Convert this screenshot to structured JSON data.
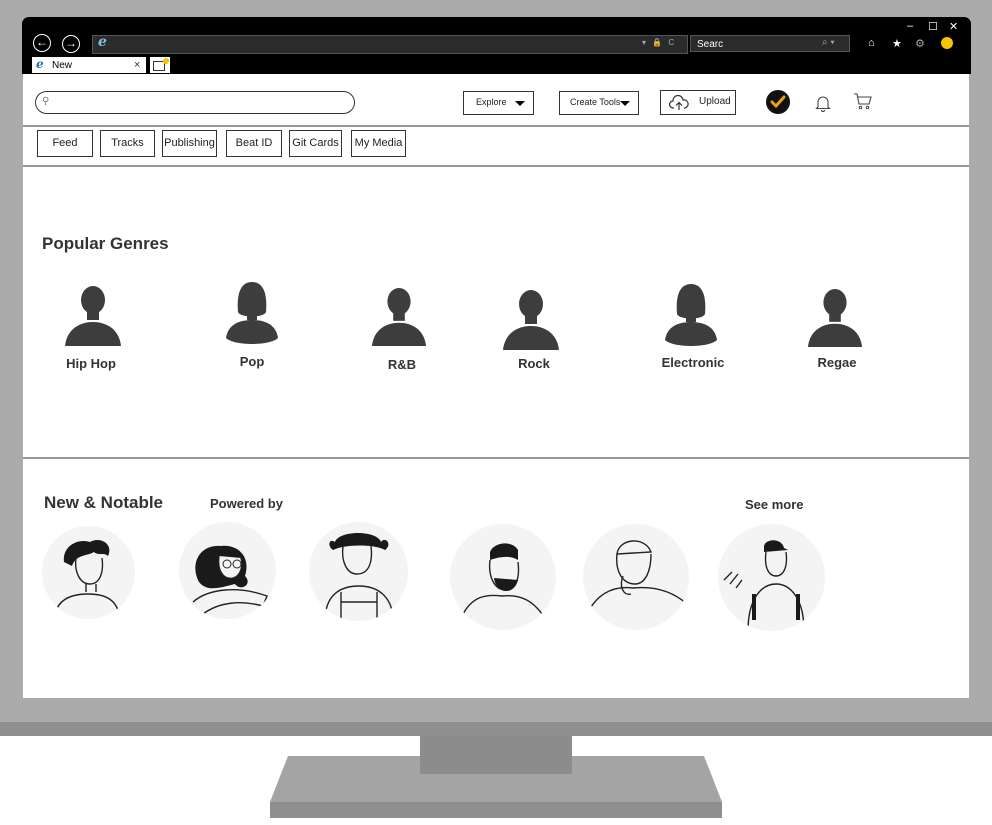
{
  "browser": {
    "tab_title": "New",
    "search_placeholder": "Searc",
    "address_icons": "▾ 🔒 C",
    "window_controls": {
      "minimize": "–",
      "maximize": "☐",
      "close": "✕"
    }
  },
  "header": {
    "explore_label": "Explore",
    "create_tools_label": "Create Tools",
    "upload_label": "Upload"
  },
  "nav": {
    "tabs": [
      "Feed",
      "Tracks",
      "Publishing",
      "Beat ID",
      "Git Cards",
      "My Media"
    ]
  },
  "popular_genres": {
    "title": "Popular Genres",
    "items": [
      {
        "label": "Hip Hop",
        "icon": "male-silhouette-icon"
      },
      {
        "label": "Pop",
        "icon": "female-silhouette-icon"
      },
      {
        "label": "R&B",
        "icon": "male-silhouette-icon"
      },
      {
        "label": "Rock",
        "icon": "male-silhouette-icon"
      },
      {
        "label": "Electronic",
        "icon": "female-silhouette-icon"
      },
      {
        "label": "Regae",
        "icon": "male-silhouette-icon"
      }
    ]
  },
  "new_notable": {
    "title": "New & Notable",
    "powered_by": "Powered by",
    "see_more": "See more",
    "artists": [
      "artist-avatar-1",
      "artist-avatar-2",
      "artist-avatar-3",
      "artist-avatar-4",
      "artist-avatar-5",
      "artist-avatar-6"
    ]
  },
  "colors": {
    "chrome": "#000000",
    "monitor": "#ababab",
    "silhouette": "#3d3d3d",
    "badge_accent": "#e8a317"
  }
}
